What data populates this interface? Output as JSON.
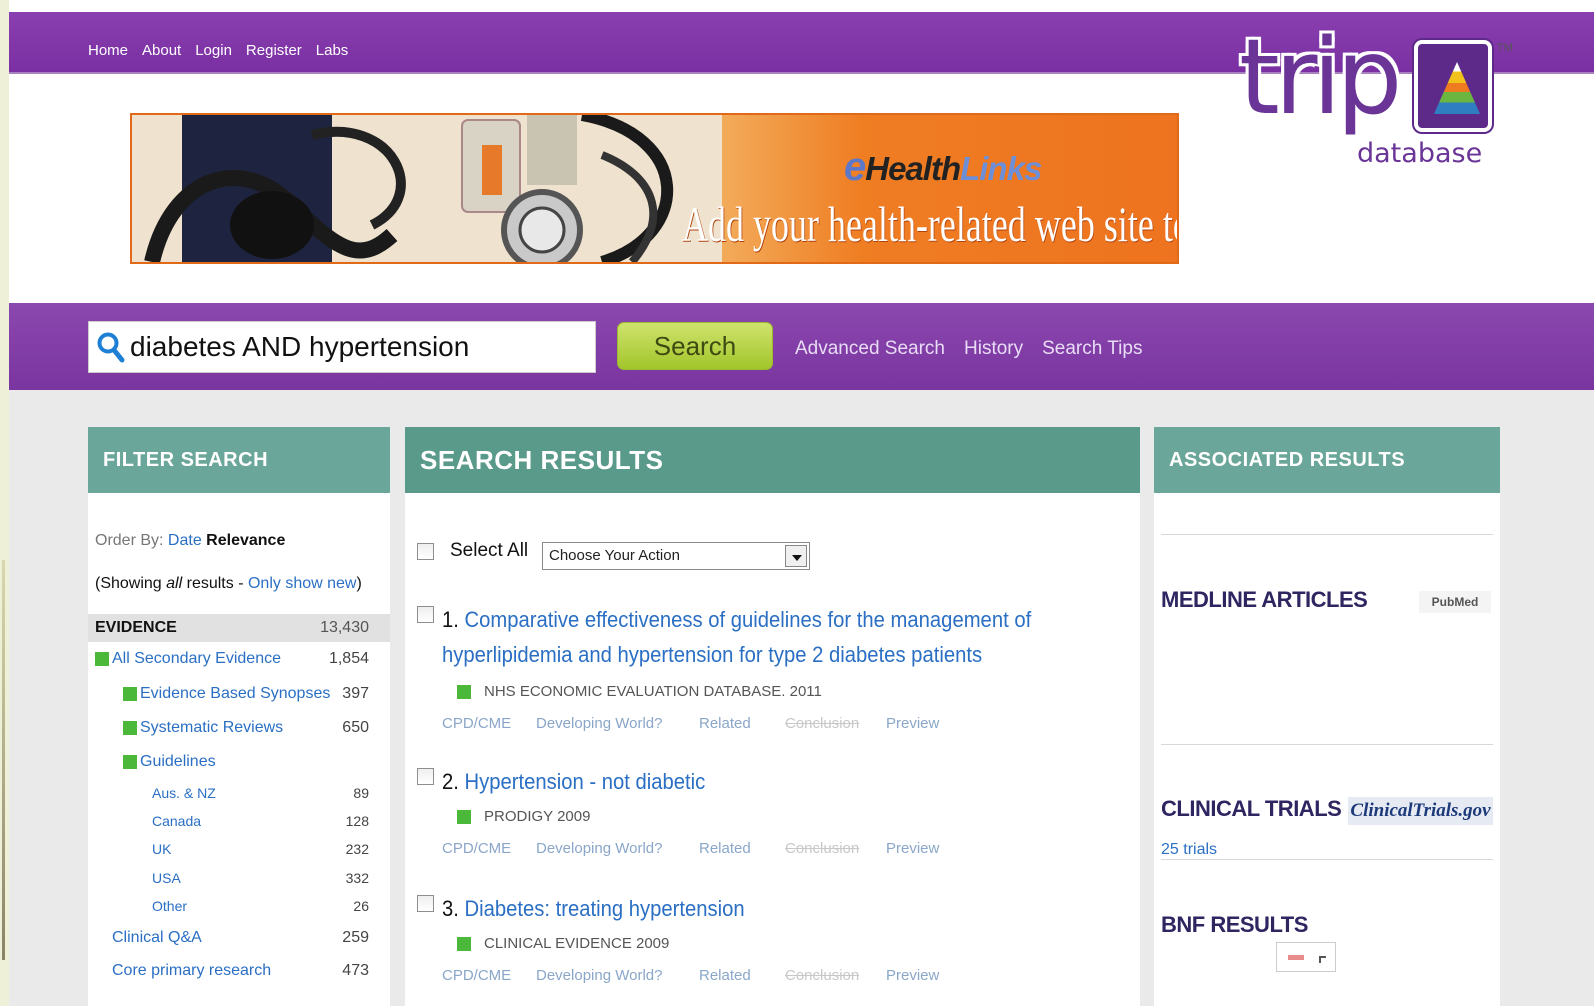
{
  "nav": {
    "items": [
      "Home",
      "About",
      "Login",
      "Register",
      "Labs"
    ]
  },
  "logo": {
    "word": "trip",
    "tm": "TM",
    "sub": "database"
  },
  "banner": {
    "brand_e": "e",
    "brand_health": "Health",
    "brand_links": "Links",
    "tagline": "Add your health-related web site today."
  },
  "search": {
    "query": "diabetes AND hypertension",
    "button": "Search",
    "links": [
      "Advanced Search",
      "History",
      "Search Tips"
    ]
  },
  "filter": {
    "heading": "FILTER SEARCH",
    "order_label": "Order By:",
    "order_date": "Date",
    "order_relevance": "Relevance",
    "showing_prefix": "(Showing ",
    "showing_all": "all",
    "showing_mid": " results - ",
    "showing_link": "Only show new",
    "showing_suffix": ")",
    "evidence_label": "EVIDENCE",
    "evidence_count": "13,430",
    "rows": [
      {
        "label": "All Secondary Evidence",
        "count": "1,854"
      },
      {
        "label": "Evidence Based Synopses",
        "count": "397"
      },
      {
        "label": "Systematic Reviews",
        "count": "650"
      },
      {
        "label": "Guidelines",
        "count": ""
      },
      {
        "label": "Aus. & NZ",
        "count": "89"
      },
      {
        "label": "Canada",
        "count": "128"
      },
      {
        "label": "UK",
        "count": "232"
      },
      {
        "label": "USA",
        "count": "332"
      },
      {
        "label": "Other",
        "count": "26"
      },
      {
        "label": "Clinical Q&A",
        "count": "259"
      },
      {
        "label": "Core primary research",
        "count": "473"
      }
    ]
  },
  "results": {
    "heading": "SEARCH RESULTS",
    "select_all": "Select All",
    "action_placeholder": "Choose Your Action",
    "items": [
      {
        "num": "1.",
        "title": "Comparative effectiveness of guidelines for the management of hyperlipidemia and hypertension for type 2 diabetes patients",
        "source": "NHS ECONOMIC EVALUATION DATABASE. 2011"
      },
      {
        "num": "2.",
        "title": "Hypertension - not diabetic",
        "source": "PRODIGY 2009"
      },
      {
        "num": "3.",
        "title": "Diabetes: treating hypertension",
        "source": "CLINICAL EVIDENCE 2009"
      }
    ],
    "links": {
      "cpd": "CPD/CME",
      "developing": "Developing World?",
      "related": "Related",
      "conclusion": "Conclusion",
      "preview": "Preview"
    }
  },
  "assoc": {
    "heading": "ASSOCIATED RESULTS",
    "medline": "MEDLINE ARTICLES",
    "pubmed": "PubMed",
    "clinical": "CLINICAL TRIALS",
    "ctgov": "ClinicalTrials.gov",
    "trials": "25 trials",
    "bnf": "BNF RESULTS"
  },
  "colors": {
    "purple": "#7a30a2",
    "teal_header": "#5a9a8a",
    "link_blue": "#2a6fc4",
    "green_badge": "#4cb83a",
    "search_btn": "#a2c52a",
    "banner_orange": "#ee7320"
  }
}
